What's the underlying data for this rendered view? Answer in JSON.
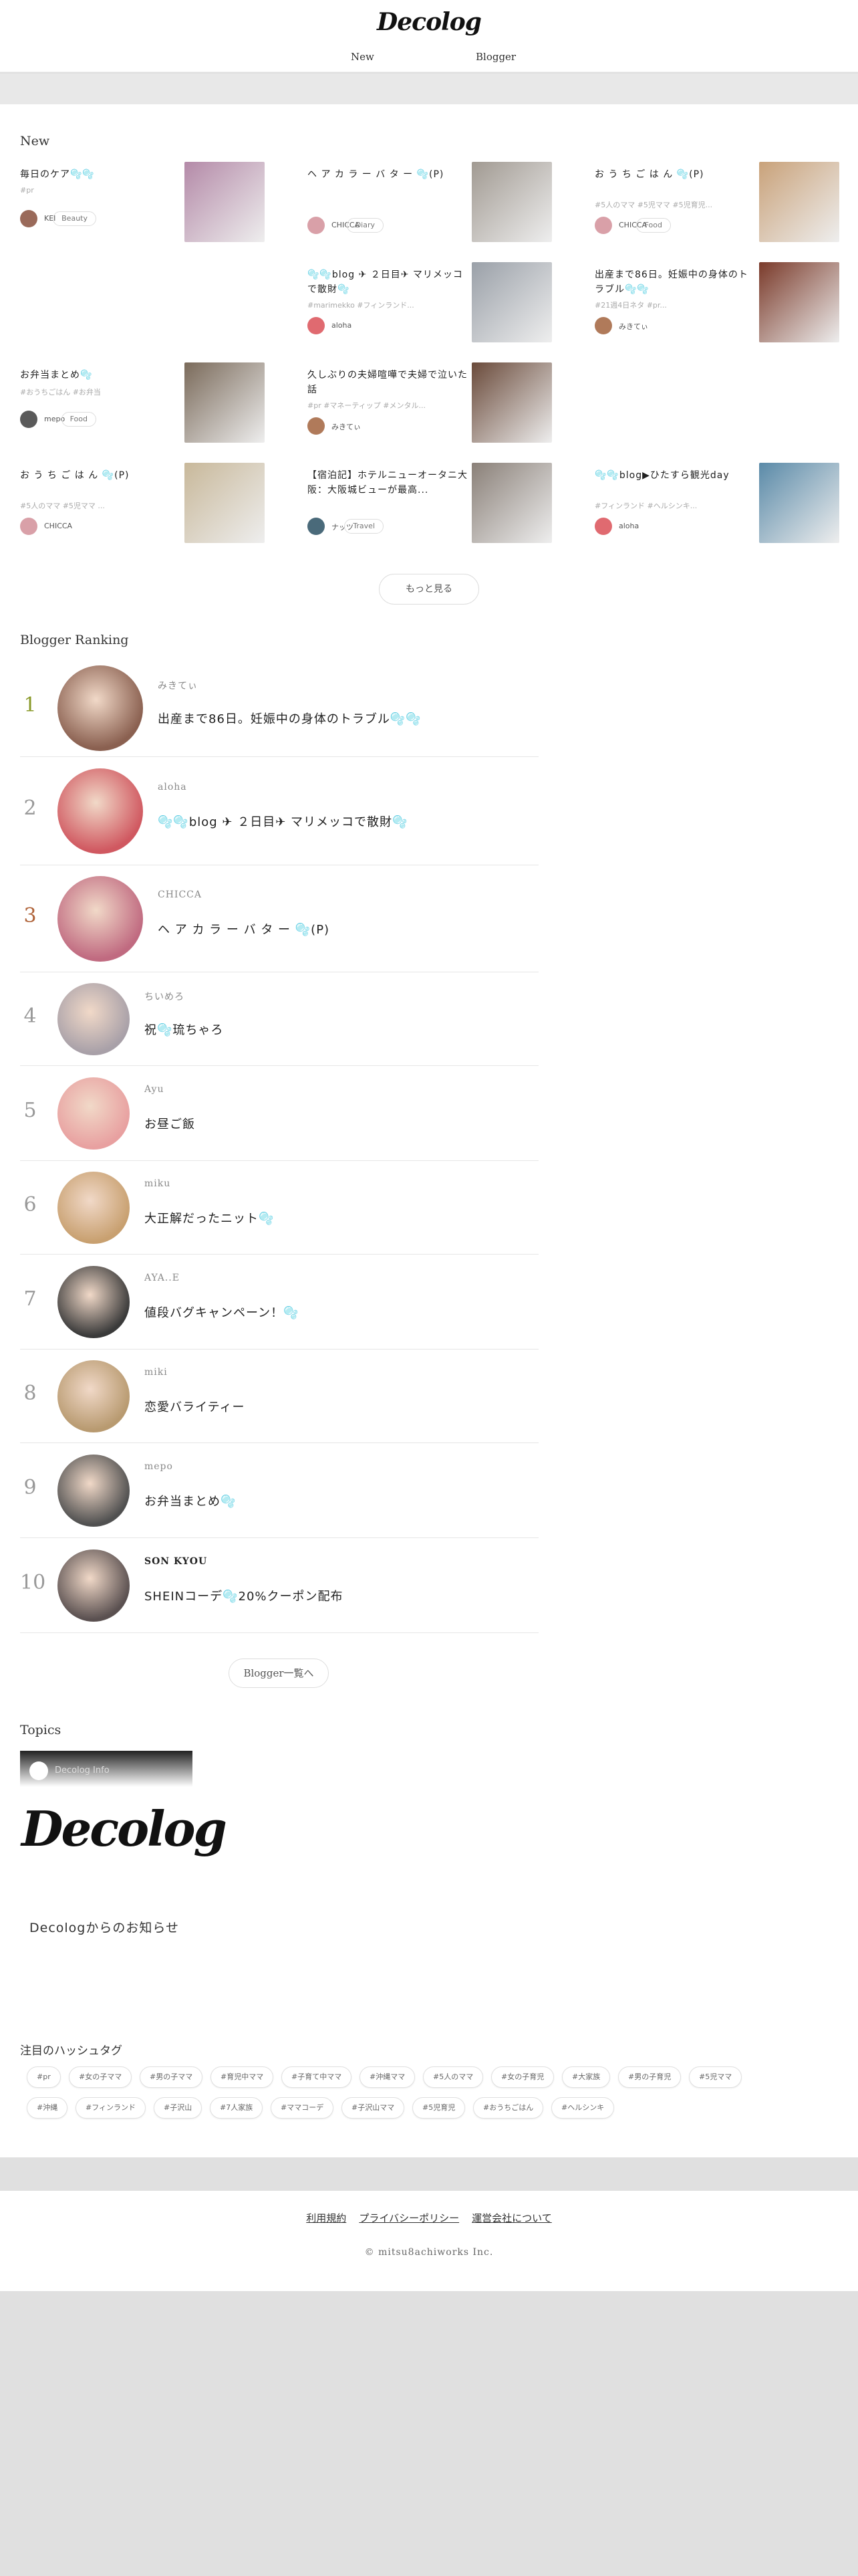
{
  "header": {
    "logo": "Decolog",
    "nav": [
      "New",
      "Blogger"
    ]
  },
  "new_section": {
    "title": "New",
    "more_label": "もっと見る",
    "cards": [
      {
        "title": "毎日のケア🫧🫧",
        "tags": "#pr",
        "author": "KEI",
        "badge": "Beauty",
        "avatar_color": "#9a6a5a",
        "thumb_color": "#b48aa8"
      },
      {
        "title": "ヘ ア カ ラ ー バ タ ー 🫧(𝖯)",
        "tags": "",
        "author": "CHICCA",
        "badge": "Diary",
        "avatar_color": "#d9a0a8",
        "thumb_color": "#a19a92"
      },
      {
        "title": "お う ち ご は ん 🫧(𝖯)",
        "tags": "#5人のママ #5児ママ #5児育児...",
        "author": "CHICCA",
        "badge": "Food",
        "avatar_color": "#d9a0a8",
        "thumb_color": "#c9a27a"
      },
      {
        "title": "🫧🫧blog ✈︎ ２日目✈︎ マリメッコで散財🫧",
        "tags": "#marimekko #フィンランド...",
        "author": "aloha",
        "badge": "",
        "avatar_color": "#e06a70",
        "thumb_color": "#9aa0a8"
      },
      {
        "title": "出産まで86日。妊娠中の身体のトラブル🫧🫧",
        "tags": "#21週4日ネタ #pr...",
        "author": "みきてぃ",
        "badge": "",
        "avatar_color": "#b07a5a",
        "thumb_color": "#7a3a2a"
      },
      {
        "title": "お弁当まとめ🫧",
        "tags": "#おうちごはん #お弁当",
        "author": "mepo",
        "badge": "Food",
        "avatar_color": "#5a5a5a",
        "thumb_color": "#7a6a5a"
      },
      {
        "title": "久しぶりの夫婦喧嘩で夫婦で泣いた話",
        "tags": "#pr #マネーティップ #メンタル...",
        "author": "みきてぃ",
        "badge": "",
        "avatar_color": "#b07a5a",
        "thumb_color": "#6a4a3a"
      },
      {
        "title": "お う ち ご は ん 🫧(𝖯)",
        "tags": "#5人のママ #5児ママ ...",
        "author": "CHICCA",
        "badge": "",
        "avatar_color": "#d9a0a8",
        "thumb_color": "#c8b89a"
      },
      {
        "title": "【宿泊記】ホテルニューオータニ大阪：大阪城ビューが最高...",
        "tags": "",
        "author": "ナッツ",
        "badge": "Travel",
        "avatar_color": "#4a6a7a",
        "thumb_color": "#8a8078"
      },
      {
        "title": "🫧🫧blog▶︎ひたすら観光day",
        "tags": "#フィンランド #ヘルシンキ...",
        "author": "aloha",
        "badge": "",
        "avatar_color": "#e06a70",
        "thumb_color": "#5a8aa8"
      }
    ]
  },
  "ranking": {
    "title": "Blogger Ranking",
    "list_label": "Blogger一覧へ",
    "items": [
      {
        "rank": "1",
        "name": "みきてぃ",
        "post": "出産まで86日。妊娠中の身体のトラブル🫧🫧",
        "color": "#8a9a2a",
        "avatar_color": "#8a6050"
      },
      {
        "rank": "2",
        "name": "aloha",
        "post": "🫧🫧blog ✈︎ ２日目✈︎ マリメッコで散財🫧",
        "color": "#999999",
        "avatar_color": "#d05860"
      },
      {
        "rank": "3",
        "name": "CHICCA",
        "post": "ヘ ア カ ラ ー バ タ ー 🫧(𝖯)",
        "color": "#b0643a",
        "avatar_color": "#c06a80"
      },
      {
        "rank": "4",
        "name": "ちいめろ",
        "post": "祝🫧琉ちゃろ",
        "color": "#999999",
        "avatar_color": "#a8a0a8"
      },
      {
        "rank": "5",
        "name": "Ayu",
        "post": "お昼ご飯",
        "color": "#999999",
        "avatar_color": "#e8a0a0"
      },
      {
        "rank": "6",
        "name": "miku",
        "post": "大正解だったニット🫧",
        "color": "#999999",
        "avatar_color": "#c8a070"
      },
      {
        "rank": "7",
        "name": "AYA..E",
        "post": "値段バグキャンペーン！🫧",
        "color": "#999999",
        "avatar_color": "#3a3a3a"
      },
      {
        "rank": "8",
        "name": "miki",
        "post": "恋愛バライティー",
        "color": "#999999",
        "avatar_color": "#b89a70"
      },
      {
        "rank": "9",
        "name": "mepo",
        "post": "お弁当まとめ🫧",
        "color": "#999999",
        "avatar_color": "#505050"
      },
      {
        "rank": "10",
        "name": "SON KYOU",
        "post": "SHEINコーデ🫧20%クーポン配布",
        "color": "#999999",
        "avatar_color": "#5a5050"
      }
    ]
  },
  "topics": {
    "title": "Topics",
    "card_label": "Decolog Info",
    "card_logo": "Decolog",
    "card_text": "Decologからのお知らせ"
  },
  "hashtags": {
    "title": "注目のハッシュタグ",
    "row1": [
      "#pr",
      "#女の子ママ",
      "#男の子ママ",
      "#育児中ママ",
      "#子育て中ママ",
      "#沖縄ママ",
      "#5人のママ",
      "#女の子育児",
      "#大家族",
      "#男の子育児",
      "#5児ママ"
    ],
    "row2": [
      "#沖縄",
      "#フィンランド",
      "#子沢山",
      "#7人家族",
      "#ママコーデ",
      "#子沢山ママ",
      "#5児育児",
      "#おうちごはん",
      "#ヘルシンキ"
    ]
  },
  "footer": {
    "links": [
      "利用規約",
      "プライバシーポリシー",
      "運営会社について"
    ],
    "copyright": "© mitsu8achiworks Inc."
  }
}
